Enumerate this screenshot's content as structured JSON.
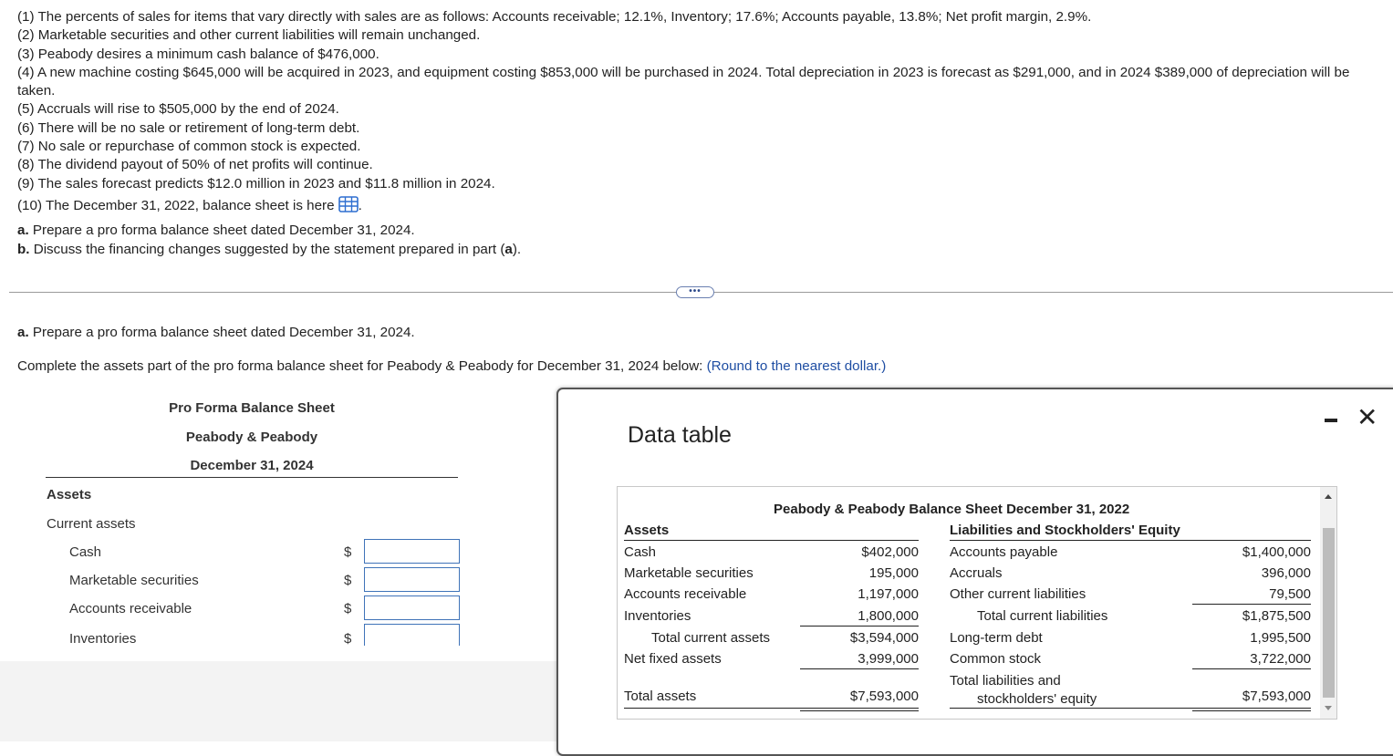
{
  "problem": {
    "lines": [
      "(1) The percents of sales for items that vary directly with sales are as follows: Accounts receivable; 12.1%, Inventory; 17.6%; Accounts payable, 13.8%; Net profit margin, 2.9%.",
      "(2) Marketable securities and other current liabilities will remain unchanged.",
      "(3) Peabody desires a minimum cash balance of $476,000.",
      "(4) A new machine costing $645,000 will be acquired in 2023, and equipment costing $853,000 will be purchased in 2024. Total depreciation in 2023 is forecast as $291,000, and in 2024 $389,000 of depreciation will be taken.",
      "(5) Accruals will rise to $505,000 by the end of 2024.",
      "(6) There will be no sale or retirement of long-term debt.",
      "(7) No sale or repurchase of common stock is expected.",
      "(8) The dividend payout of 50% of net profits will continue.",
      "(9) The sales forecast predicts $12.0 million in 2023 and $11.8 million in 2024."
    ],
    "line10": "(10) The December 31, 2022, balance sheet is here",
    "line10_end": ".",
    "part_a_letter": "a.",
    "part_a_text": " Prepare a pro forma balance sheet dated December 31, 2024.",
    "part_b_letter": "b.",
    "part_b_text": " Discuss the financing changes suggested by the statement prepared in part (",
    "part_b_ref": "a",
    "part_b_end": ")."
  },
  "divider": {
    "ellipsis": "•••"
  },
  "question": {
    "a_letter": "a.",
    "a_text": " Prepare a pro forma balance sheet dated December 31, 2024.",
    "instruction": "Complete the assets part of the pro forma balance sheet for Peabody & Peabody for December 31, 2024 below: ",
    "hint": "(Round to the nearest dollar.)"
  },
  "proforma": {
    "title": "Pro Forma Balance Sheet",
    "company": "Peabody & Peabody",
    "date": "December 31, 2024",
    "assets_header": "Assets",
    "current_assets": "Current assets",
    "rows": [
      {
        "label": "Cash",
        "currency": "$",
        "value": ""
      },
      {
        "label": "Marketable securities",
        "currency": "$",
        "value": ""
      },
      {
        "label": "Accounts receivable",
        "currency": "$",
        "value": ""
      },
      {
        "label": "Inventories",
        "currency": "$",
        "value": ""
      }
    ]
  },
  "modal": {
    "title": "Data table",
    "minimize": "",
    "close": "✕",
    "table": {
      "title": "Peabody & Peabody Balance Sheet December 31, 2022",
      "assets_header": "Assets",
      "liab_header": "Liabilities and Stockholders' Equity",
      "assets": [
        {
          "label": "Cash",
          "value": "$402,000"
        },
        {
          "label": "Marketable securities",
          "value": "195,000"
        },
        {
          "label": "Accounts receivable",
          "value": "1,197,000"
        },
        {
          "label": "Inventories",
          "value": "1,800,000"
        },
        {
          "label": "Total current assets",
          "value": "$3,594,000"
        },
        {
          "label": "Net fixed assets",
          "value": "3,999,000"
        },
        {
          "label": "Total assets",
          "value": "$7,593,000"
        }
      ],
      "liabilities": [
        {
          "label": "Accounts payable",
          "value": "$1,400,000"
        },
        {
          "label": "Accruals",
          "value": "396,000"
        },
        {
          "label": "Other current liabilities",
          "value": "79,500"
        },
        {
          "label": "Total current liabilities",
          "value": "$1,875,500"
        },
        {
          "label": "Long-term debt",
          "value": "1,995,500"
        },
        {
          "label": "Common stock",
          "value": "3,722,000"
        },
        {
          "label": "Total liabilities and",
          "label2": "stockholders' equity",
          "value": "$7,593,000"
        }
      ]
    }
  },
  "colors": {
    "link_blue": "#1f4ea3",
    "input_border": "#3f73b8",
    "grid_icon": "#2f6fd0"
  }
}
